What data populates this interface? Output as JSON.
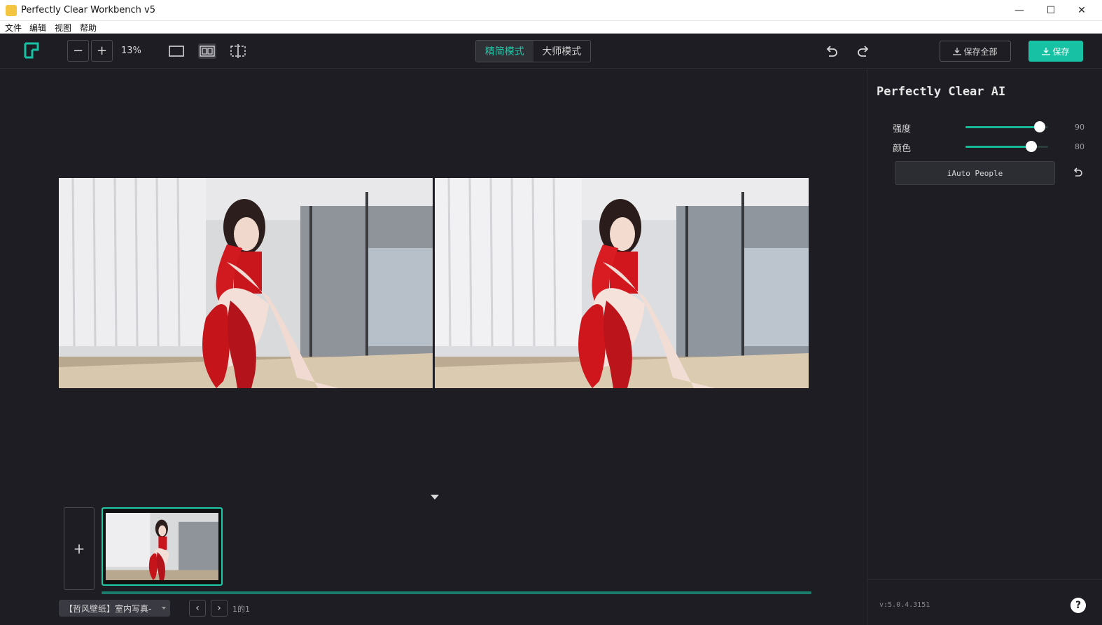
{
  "window": {
    "title": "Perfectly Clear Workbench v5",
    "min_glyph": "—",
    "max_glyph": "☐",
    "close_glyph": "✕"
  },
  "menu": {
    "items": [
      "文件",
      "编辑",
      "视图",
      "帮助"
    ]
  },
  "toolbar": {
    "zoom_out": "−",
    "zoom_in": "+",
    "zoom_level": "13%",
    "mode_simple": "精简模式",
    "mode_master": "大师模式",
    "save_all": "保存全部",
    "save": "保存"
  },
  "panel": {
    "title": "Perfectly Clear AI",
    "sliders": [
      {
        "label": "强度",
        "value": 90,
        "display": "90"
      },
      {
        "label": "颜色",
        "value": 80,
        "display": "80"
      }
    ],
    "preset": "iAuto People",
    "version": "v:5.0.4.3151",
    "help": "?"
  },
  "filmstrip": {
    "add": "+",
    "folder": "【哲风壁纸】室内写真-",
    "prev": "‹",
    "next": "›",
    "page_info": "1的1",
    "progress": 1.0
  },
  "colors": {
    "accent": "#16c2a3",
    "background": "#1e1d23"
  },
  "icons": [
    "logo-icon",
    "single-view-icon",
    "side-by-side-view-icon",
    "split-view-icon",
    "undo-icon",
    "redo-icon",
    "download-icon",
    "reset-icon",
    "help-icon",
    "collapse-arrow-icon"
  ]
}
